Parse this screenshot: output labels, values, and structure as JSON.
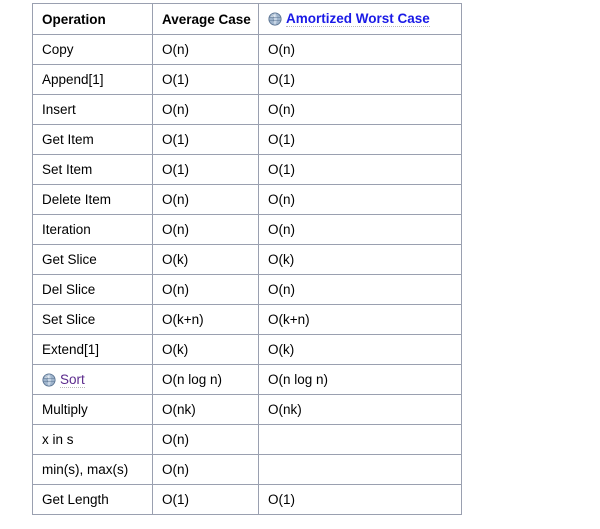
{
  "table": {
    "headers": [
      {
        "label": "Operation",
        "icon": null,
        "link": false
      },
      {
        "label": "Average Case",
        "icon": null,
        "link": false
      },
      {
        "label": "Amortized Worst Case",
        "icon": "globe-icon",
        "link": true
      }
    ],
    "rows": [
      {
        "operation": "Copy",
        "icon": null,
        "link": false,
        "average": "O(n)",
        "worst": "O(n)"
      },
      {
        "operation": "Append[1]",
        "icon": null,
        "link": false,
        "average": "O(1)",
        "worst": "O(1)"
      },
      {
        "operation": "Insert",
        "icon": null,
        "link": false,
        "average": "O(n)",
        "worst": "O(n)"
      },
      {
        "operation": "Get Item",
        "icon": null,
        "link": false,
        "average": "O(1)",
        "worst": "O(1)"
      },
      {
        "operation": "Set Item",
        "icon": null,
        "link": false,
        "average": "O(1)",
        "worst": "O(1)"
      },
      {
        "operation": "Delete Item",
        "icon": null,
        "link": false,
        "average": "O(n)",
        "worst": "O(n)"
      },
      {
        "operation": "Iteration",
        "icon": null,
        "link": false,
        "average": "O(n)",
        "worst": "O(n)"
      },
      {
        "operation": "Get Slice",
        "icon": null,
        "link": false,
        "average": "O(k)",
        "worst": "O(k)"
      },
      {
        "operation": "Del Slice",
        "icon": null,
        "link": false,
        "average": "O(n)",
        "worst": "O(n)"
      },
      {
        "operation": "Set Slice",
        "icon": null,
        "link": false,
        "average": "O(k+n)",
        "worst": "O(k+n)"
      },
      {
        "operation": "Extend[1]",
        "icon": null,
        "link": false,
        "average": "O(k)",
        "worst": "O(k)"
      },
      {
        "operation": "Sort",
        "icon": "globe-icon",
        "link": true,
        "average": "O(n log n)",
        "worst": "O(n log n)"
      },
      {
        "operation": "Multiply",
        "icon": null,
        "link": false,
        "average": "O(nk)",
        "worst": "O(nk)"
      },
      {
        "operation": "x in s",
        "icon": null,
        "link": false,
        "average": "O(n)",
        "worst": ""
      },
      {
        "operation": "min(s), max(s)",
        "icon": null,
        "link": false,
        "average": "O(n)",
        "worst": ""
      },
      {
        "operation": "Get Length",
        "icon": null,
        "link": false,
        "average": "O(1)",
        "worst": "O(1)"
      }
    ]
  },
  "colors": {
    "link_unvisited": "#1a1ae6",
    "link_visited": "#5b2a8c",
    "border": "#9aa0b0",
    "text": "#000000",
    "background": "#ffffff",
    "underline_dotted": "#b9b9b9"
  }
}
